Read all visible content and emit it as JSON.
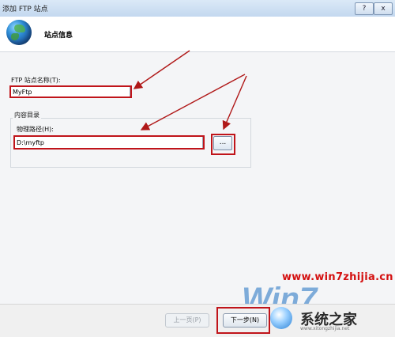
{
  "window": {
    "title": "添加 FTP 站点",
    "help_label": "?",
    "close_label": "x"
  },
  "header": {
    "title": "站点信息",
    "icon": "globe-icon"
  },
  "form": {
    "site_name_label": "FTP 站点名称(T):",
    "site_name_value": "MyFtp",
    "group_label": "内容目录",
    "physical_path_label": "物理路径(H):",
    "physical_path_value": "D:\\myftp",
    "browse_label": "..."
  },
  "footer": {
    "prev_label": "上一页(P)",
    "next_label": "下一步(N)"
  },
  "watermark": {
    "url": "www.win7zhijia.cn",
    "win7_logo_text": "Win7",
    "site_name": "系统之家",
    "site_sub": "www.xitongzhijia.net"
  },
  "colors": {
    "highlight_red": "#c0141a",
    "watermark_red": "#d41010"
  }
}
